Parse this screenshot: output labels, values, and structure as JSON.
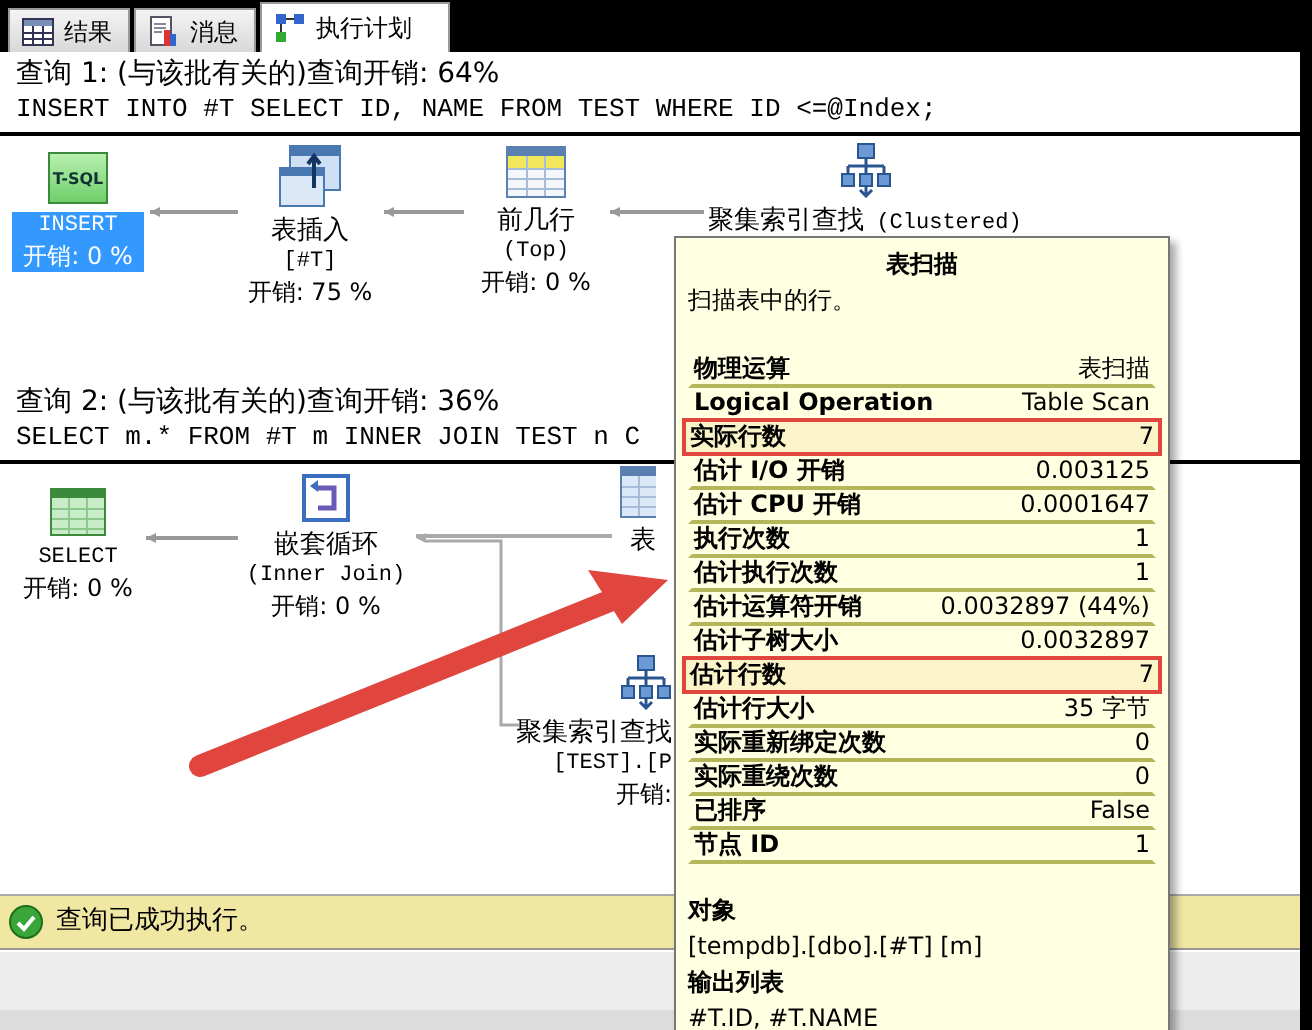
{
  "tabs": [
    {
      "label": "结果",
      "kind": "grid",
      "selected": false
    },
    {
      "label": "消息",
      "kind": "doc",
      "selected": false
    },
    {
      "label": "执行计划",
      "kind": "plan",
      "selected": true
    }
  ],
  "queries": [
    {
      "header": "查询 1: (与该批有关的)查询开销: 64%",
      "sql": "INSERT INTO #T SELECT ID, NAME FROM TEST WHERE ID <=@Index;",
      "nodes": [
        {
          "kind": "tsql",
          "icon_text": "T-SQL",
          "label": "INSERT",
          "cost": "开销: 0 %",
          "selected": true
        },
        {
          "kind": "table-insert",
          "label": "表插入",
          "sub": "[#T]",
          "cost": "开销: 75 %",
          "selected": false
        },
        {
          "kind": "top",
          "label": "前几行",
          "sub": "(Top)",
          "cost": "开销: 0 %",
          "selected": false
        },
        {
          "kind": "clustered-seek",
          "label": "聚集索引查找",
          "sub": "(Clustered)",
          "selected": false
        }
      ]
    },
    {
      "header": "查询 2: (与该批有关的)查询开销: 36%",
      "sql": "SELECT m.* FROM #T m INNER JOIN TEST n C",
      "nodes": [
        {
          "kind": "select",
          "label": "SELECT",
          "cost": "开销: 0 %",
          "selected": false
        },
        {
          "kind": "nested-loops",
          "label": "嵌套循环",
          "sub": "(Inner Join)",
          "cost": "开销: 0 %",
          "selected": false
        },
        {
          "kind": "table-scan",
          "label": "表",
          "selected": false
        },
        {
          "kind": "clustered-seek",
          "label": "聚集索引查找",
          "sub": "[TEST].[P",
          "cost": "开销:",
          "selected": false
        }
      ]
    }
  ],
  "tooltip": {
    "title": "表扫描",
    "description": "扫描表中的行。",
    "rows": [
      {
        "label": "物理运算",
        "value": "表扫描",
        "highlighted": false
      },
      {
        "label": "Logical Operation",
        "value": "Table Scan",
        "highlighted": false
      },
      {
        "label": "实际行数",
        "value": "7",
        "highlighted": true
      },
      {
        "label": "估计 I/O 开销",
        "value": "0.003125",
        "highlighted": false
      },
      {
        "label": "估计 CPU 开销",
        "value": "0.0001647",
        "highlighted": false
      },
      {
        "label": "执行次数",
        "value": "1",
        "highlighted": false
      },
      {
        "label": "估计执行次数",
        "value": "1",
        "highlighted": false
      },
      {
        "label": "估计运算符开销",
        "value": "0.0032897 (44%)",
        "highlighted": false
      },
      {
        "label": "估计子树大小",
        "value": "0.0032897",
        "highlighted": false
      },
      {
        "label": "估计行数",
        "value": "7",
        "highlighted": true
      },
      {
        "label": "估计行大小",
        "value": "35 字节",
        "highlighted": false
      },
      {
        "label": "实际重新绑定次数",
        "value": "0",
        "highlighted": false
      },
      {
        "label": "实际重绕次数",
        "value": "0",
        "highlighted": false
      },
      {
        "label": "已排序",
        "value": "False",
        "highlighted": false
      },
      {
        "label": "节点 ID",
        "value": "1",
        "highlighted": false
      }
    ],
    "sections": [
      {
        "heading": "对象",
        "text": "[tempdb].[dbo].[#T] [m]"
      },
      {
        "heading": "输出列表",
        "text": "#T.ID, #T.NAME"
      }
    ]
  },
  "status_bar": {
    "kind": "success",
    "text": "查询已成功执行。"
  }
}
